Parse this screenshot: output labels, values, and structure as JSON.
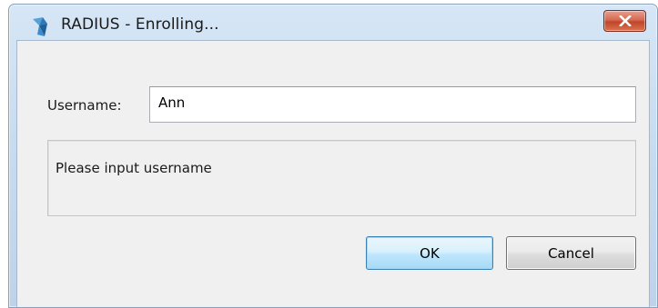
{
  "window": {
    "title": "RADIUS - Enrolling...",
    "icon": "radius-app-icon",
    "close_icon": "close-x-icon"
  },
  "form": {
    "username_label": "Username:",
    "username_value": "Ann",
    "message": "Please input username"
  },
  "buttons": {
    "ok_label": "OK",
    "cancel_label": "Cancel"
  },
  "colors": {
    "titlebar": "#c8dcf0",
    "client_bg": "#f0f0f0",
    "close_button": "#c24529",
    "ok_border": "#3c7fb1"
  }
}
